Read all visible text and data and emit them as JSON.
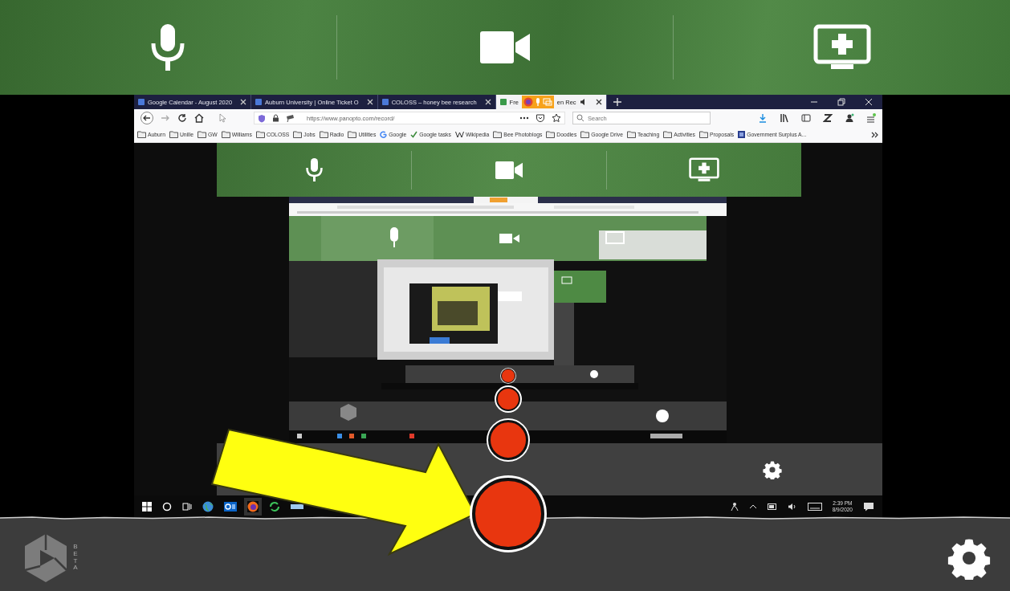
{
  "app_toolbar": {
    "buttons": [
      {
        "kind": "microphone"
      },
      {
        "kind": "camera"
      },
      {
        "kind": "add_screen"
      }
    ]
  },
  "recording_preview": {
    "browser": {
      "tabs": [
        {
          "label": "Google Calendar - August 2020",
          "selected": false
        },
        {
          "label": "Auburn University | Online Ticket O",
          "selected": false
        },
        {
          "label": "COLOSS – honey bee research",
          "selected": false
        },
        {
          "label": "Fre",
          "label_tail": "en Rec",
          "selected": true
        }
      ],
      "url": "https://www.panopto.com/record/",
      "search": {
        "placeholder": "Search"
      },
      "bookmarks": [
        {
          "label": "Auburn",
          "kind": "folder"
        },
        {
          "label": "Unille",
          "kind": "folder"
        },
        {
          "label": "GW",
          "kind": "folder"
        },
        {
          "label": "Williams",
          "kind": "folder"
        },
        {
          "label": "COLOSS",
          "kind": "folder"
        },
        {
          "label": "Jobs",
          "kind": "folder"
        },
        {
          "label": "Radio",
          "kind": "folder"
        },
        {
          "label": "Utilities",
          "kind": "folder"
        },
        {
          "label": "Google",
          "kind": "google"
        },
        {
          "label": "Google tasks",
          "kind": "check"
        },
        {
          "label": "Wikipedia",
          "kind": "wiki"
        },
        {
          "label": "Bee Photoblogs",
          "kind": "folder"
        },
        {
          "label": "Doodles",
          "kind": "folder"
        },
        {
          "label": "Google Drive",
          "kind": "folder"
        },
        {
          "label": "Teaching",
          "kind": "folder"
        },
        {
          "label": "Activities",
          "kind": "folder"
        },
        {
          "label": "Proposals",
          "kind": "folder"
        },
        {
          "label": "Government Surplus A...",
          "kind": "site"
        }
      ]
    },
    "inner_toolbar": {
      "buttons": [
        {
          "kind": "microphone"
        },
        {
          "kind": "camera"
        },
        {
          "kind": "add_screen"
        }
      ]
    },
    "taskbar": {
      "time": "2:39 PM",
      "date": "8/9/2020"
    }
  },
  "bottom_bar": {
    "logo_badge": "BETA"
  }
}
